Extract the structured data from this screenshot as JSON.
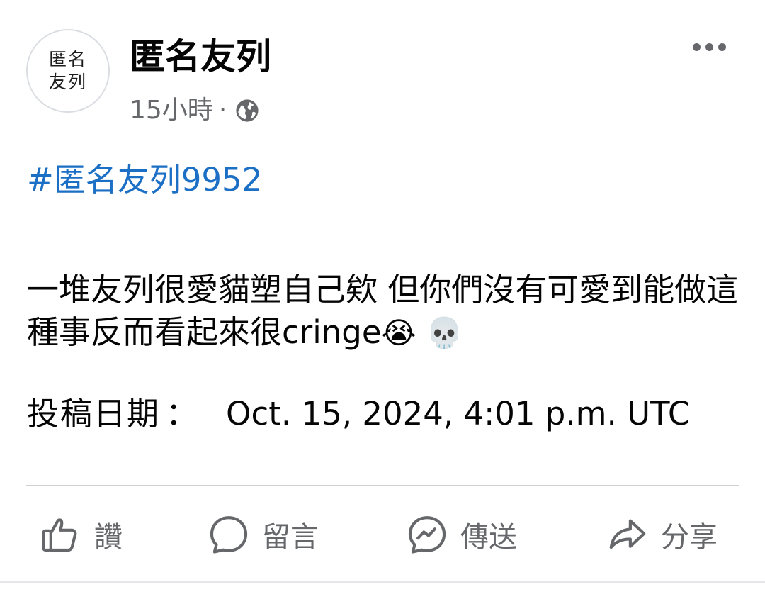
{
  "post": {
    "avatar_text": "匿名友列",
    "page_name": "匿名友列",
    "time": "15小時",
    "separator": "·",
    "audience_icon": "globe-icon",
    "more_icon": "more-dots-icon",
    "hashtag": "#匿名友列9952",
    "body_text": "一堆友列很愛貓塑自己欸 但你們沒有可愛到能做這種事反而看起來很cringe",
    "body_emojis": "😭 💀",
    "date_label": "投稿日期",
    "date_colon": "：",
    "date_value": "Oct. 15, 2024, 4:01 p.m. UTC"
  },
  "actions": [
    {
      "icon": "like-thumb-icon",
      "label": "讚"
    },
    {
      "icon": "comment-bubble-icon",
      "label": "留言"
    },
    {
      "icon": "messenger-icon",
      "label": "傳送"
    },
    {
      "icon": "share-arrow-icon",
      "label": "分享"
    }
  ],
  "colors": {
    "hashtag": "#1b6fc5",
    "meta_text": "#65676b",
    "primary_text": "#050505",
    "divider": "#ced0d4"
  }
}
